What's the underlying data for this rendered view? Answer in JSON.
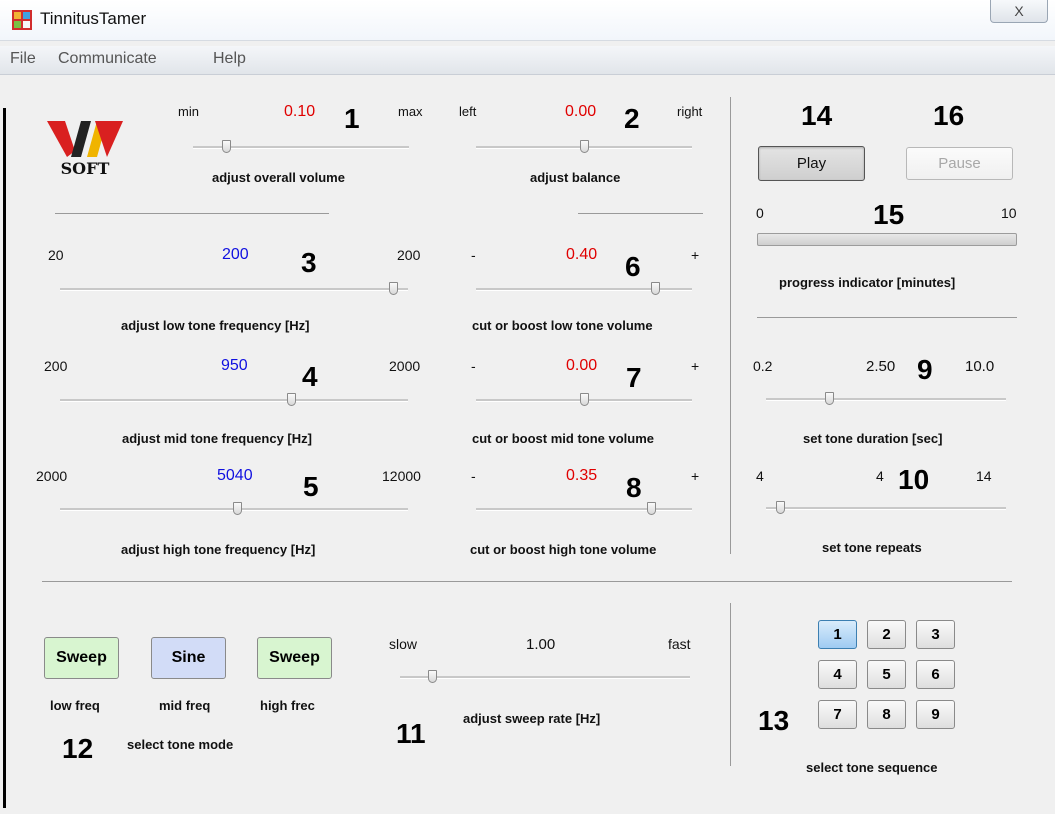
{
  "window": {
    "title": "TinnitusTamer",
    "close_glyph": "X"
  },
  "menu": {
    "items": [
      "File",
      "Communicate",
      "Help"
    ]
  },
  "icons": {
    "app": "tinnitus-tamer-app-icon",
    "logo": "vav-soft-logo"
  },
  "colors": {
    "value_red": "#e00000",
    "value_blue": "#1010e0",
    "sweep_bg": "#d8f5d0",
    "sine_bg": "#d2dcf7",
    "seq_selected": "#9fcbf2"
  },
  "volume": {
    "min": "min",
    "max": "max",
    "value": "0.10",
    "number": "1",
    "caption": "adjust overall volume",
    "fraction": 0.1
  },
  "balance": {
    "left": "left",
    "right": "right",
    "value": "0.00",
    "number": "2",
    "caption": "adjust balance",
    "fraction": 0.5
  },
  "low_freq": {
    "min": "20",
    "max": "200",
    "value": "200",
    "number": "3",
    "caption": "adjust low tone frequency [Hz]",
    "fraction": 1.0
  },
  "mid_freq": {
    "min": "200",
    "max": "2000",
    "value": "950",
    "number": "4",
    "caption": "adjust mid tone frequency [Hz]",
    "fraction": 0.68
  },
  "high_freq": {
    "min": "2000",
    "max": "12000",
    "value": "5040",
    "number": "5",
    "caption": "adjust high tone frequency [Hz]",
    "fraction": 0.51
  },
  "low_vol": {
    "minus": "-",
    "plus": "+",
    "value": "0.40",
    "number": "6",
    "caption": "cut or boost low tone volume",
    "fraction": 0.88
  },
  "mid_vol": {
    "minus": "-",
    "plus": "+",
    "value": "0.00",
    "number": "7",
    "caption": "cut or boost mid tone volume",
    "fraction": 0.5
  },
  "high_vol": {
    "minus": "-",
    "plus": "+",
    "value": "0.35",
    "number": "8",
    "caption": "cut or boost high tone volume",
    "fraction": 0.86
  },
  "duration": {
    "min": "0.2",
    "max": "10.0",
    "value": "2.50",
    "number": "9",
    "caption": "set tone duration [sec]",
    "fraction": 0.23
  },
  "repeats": {
    "min": "4",
    "max": "14",
    "value": "4",
    "number": "10",
    "caption": "set tone repeats",
    "fraction": 0.0
  },
  "sweep": {
    "slow": "slow",
    "fast": "fast",
    "value": "1.00",
    "number": "11",
    "caption": "adjust sweep rate [Hz]",
    "fraction": 0.07
  },
  "tone_mode": {
    "number": "12",
    "caption": "select tone mode",
    "buttons": [
      {
        "label": "Sweep",
        "sub": "low freq"
      },
      {
        "label": "Sine",
        "sub": "mid freq"
      },
      {
        "label": "Sweep",
        "sub": "high frec"
      }
    ]
  },
  "sequence": {
    "number": "13",
    "caption": "select tone sequence",
    "buttons": [
      "1",
      "2",
      "3",
      "4",
      "5",
      "6",
      "7",
      "8",
      "9"
    ],
    "selected": "1"
  },
  "play": {
    "number": "14",
    "label": "Play"
  },
  "progress": {
    "number": "15",
    "min": "0",
    "max": "10",
    "caption": "progress indicator [minutes]",
    "fraction": 0.0
  },
  "pause": {
    "number": "16",
    "label": "Pause"
  }
}
